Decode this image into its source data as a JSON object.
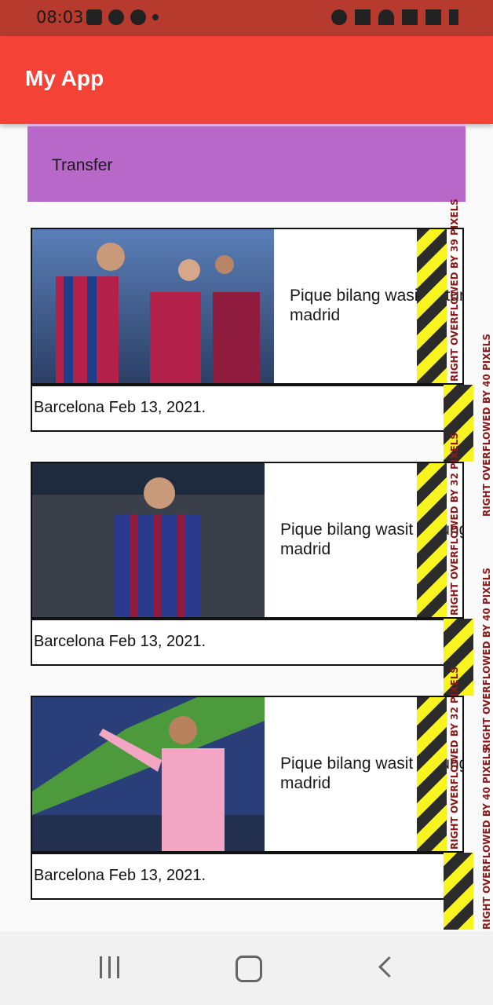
{
  "status_bar": {
    "time": "08:03"
  },
  "app_bar": {
    "title": "My App"
  },
  "transfer": {
    "label": "Transfer"
  },
  "cards": [
    {
      "title": "Pique bilang wasit untungkan madrid",
      "title_line1": "Pique bilang wasit untungk",
      "title_line2": "madrid",
      "date": "Barcelona Feb 13, 2021.",
      "overflow_top": "RIGHT OVERFLOWED BY 39 PIXELS",
      "overflow_bottom": "RIGHT OVERFLOWED BY 40 PIXELS"
    },
    {
      "title": "Pique bilang wasit untungkan madrid",
      "title_line1": "Pique bilang wasit untungka",
      "title_line2": "madrid",
      "date": "Barcelona Feb 13, 2021.",
      "overflow_top": "RIGHT OVERFLOWED BY 32 PIXELS",
      "overflow_bottom": "RIGHT OVERFLOWED BY 40 PIXELS"
    },
    {
      "title": "Pique bilang wasit untungkan madrid",
      "title_line1": "Pique bilang wasit untungka",
      "title_line2": "madrid",
      "date": "Barcelona Feb 13, 2021.",
      "overflow_top": "RIGHT OVERFLOWED BY 32 PIXELS",
      "overflow_bottom": "RIGHT OVERFLOWED BY 40 PIXELS"
    }
  ],
  "nav_bar": {
    "icons": [
      "recent-apps-icon",
      "home-icon",
      "back-icon"
    ]
  },
  "colors": {
    "app_bar": "#f44336",
    "status_bar": "#b73a2e",
    "transfer_box": "#b768c9",
    "overflow_yellow": "#f7f41f"
  }
}
